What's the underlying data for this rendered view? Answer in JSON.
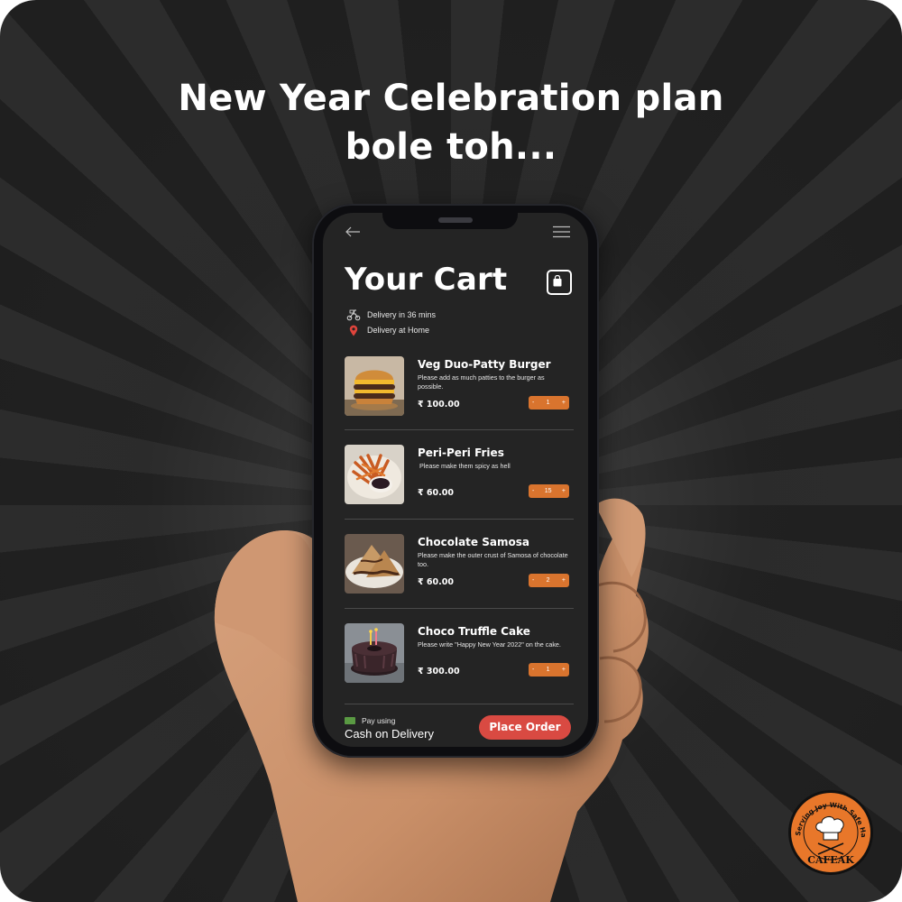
{
  "headline": {
    "line1": "New Year Celebration plan",
    "line2": "bole toh..."
  },
  "header": {
    "title": "Your Cart",
    "back_icon": "arrow-left-icon",
    "menu_icon": "hamburger-menu-icon",
    "bag_icon": "shopping-bag-icon"
  },
  "delivery": {
    "time": "Delivery in 36 mins",
    "location": "Delivery at Home"
  },
  "items": [
    {
      "name": "Veg Duo-Patty Burger",
      "note": "Please add as much patties to the burger as possible.",
      "price": "₹ 100.00",
      "qty": "1"
    },
    {
      "name": "Peri-Peri Fries",
      "note": "Please make them spicy as hell",
      "price": "₹ 60.00",
      "qty": "15"
    },
    {
      "name": "Chocolate Samosa",
      "note": "Please make the outer crust of Samosa of chocolate too.",
      "price": "₹ 60.00",
      "qty": "2"
    },
    {
      "name": "Choco Truffle Cake",
      "note": "Please write \"Happy New Year 2022\" on the cake.",
      "price": "₹ 300.00",
      "qty": "1"
    }
  ],
  "stepper": {
    "minus": "-",
    "plus": "+"
  },
  "footer": {
    "pay_label": "Pay using",
    "pay_method": "Cash on Delivery",
    "button": "Place Order"
  },
  "logo": {
    "arc_text": "Serving Joy With Safe Hands",
    "brand": "CAFEAK"
  },
  "colors": {
    "accent_orange": "#d9742e",
    "button_red": "#d94a42",
    "screen_bg": "#242424",
    "logo_orange": "#e8772a"
  }
}
